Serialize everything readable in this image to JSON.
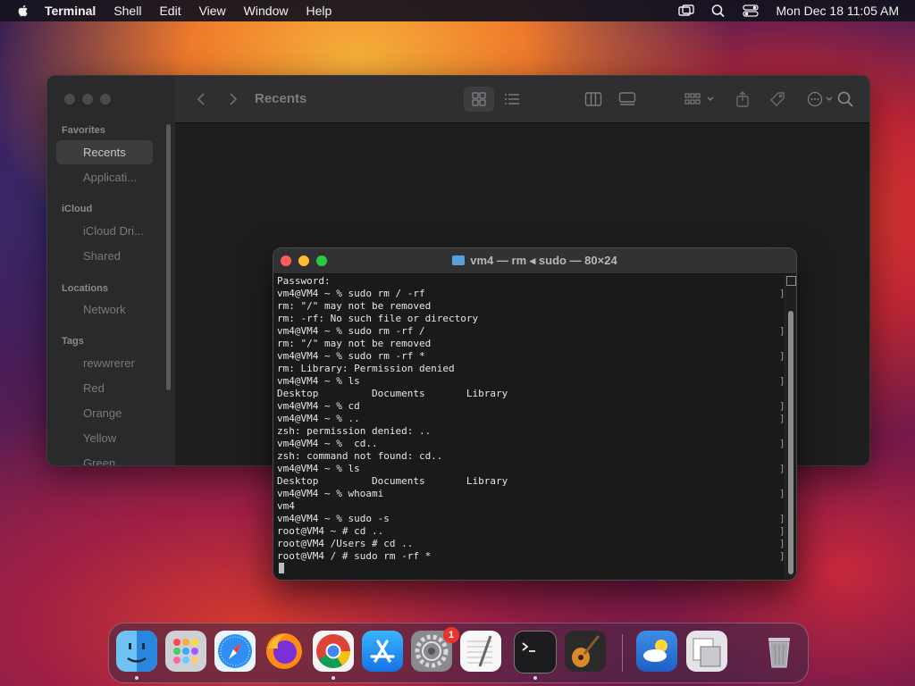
{
  "menubar": {
    "app_name": "Terminal",
    "menus": [
      "Shell",
      "Edit",
      "View",
      "Window",
      "Help"
    ],
    "clock": "Mon Dec 18  11:05 AM"
  },
  "finder": {
    "title": "Recents",
    "sidebar": {
      "favorites_header": "Favorites",
      "favorites": [
        "Recents",
        "Applicati..."
      ],
      "icloud_header": "iCloud",
      "icloud": [
        "iCloud Dri...",
        "Shared"
      ],
      "locations_header": "Locations",
      "locations": [
        "Network"
      ],
      "tags_header": "Tags",
      "tags": [
        "rewwrerer",
        "Red",
        "Orange",
        "Yellow",
        "Green"
      ]
    }
  },
  "terminal": {
    "title": "vm4 — rm ◂ sudo — 80×24",
    "lines": [
      "Password:",
      "vm4@VM4 ~ % sudo rm / -rf",
      "rm: \"/\" may not be removed",
      "rm: -rf: No such file or directory",
      "vm4@VM4 ~ % sudo rm -rf /",
      "rm: \"/\" may not be removed",
      "vm4@VM4 ~ % sudo rm -rf *",
      "rm: Library: Permission denied",
      "vm4@VM4 ~ % ls",
      "Desktop         Documents       Library",
      "vm4@VM4 ~ % cd",
      "vm4@VM4 ~ % ..",
      "zsh: permission denied: ..",
      "vm4@VM4 ~ %  cd..",
      "zsh: command not found: cd..",
      "vm4@VM4 ~ % ls",
      "Desktop         Documents       Library",
      "vm4@VM4 ~ % whoami",
      "vm4",
      "vm4@VM4 ~ % sudo -s",
      "root@VM4 ~ # cd ..",
      "root@VM4 /Users # cd ..",
      "root@VM4 / # sudo rm -rf *"
    ]
  },
  "dock": {
    "apps": [
      "Finder",
      "Launchpad",
      "Safari",
      "Firefox",
      "Chrome",
      "App Store",
      "System Settings",
      "TextEdit",
      "Terminal",
      "GarageBand",
      "Weather",
      "Preview",
      "Trash"
    ],
    "settings_badge": "1"
  },
  "colors": {
    "accent": "#0a84ff",
    "close": "#ff5f57",
    "minimize": "#febc2e",
    "zoom": "#28c840"
  }
}
